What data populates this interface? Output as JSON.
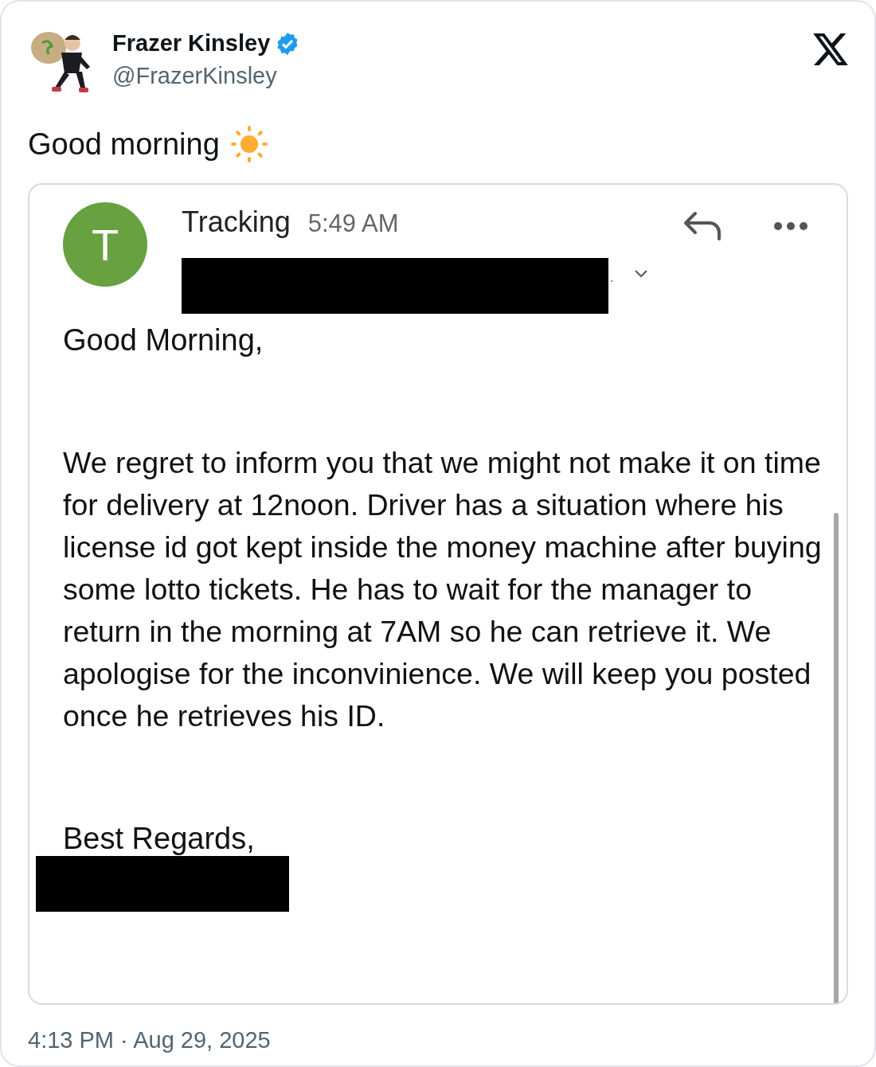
{
  "author": {
    "name": "Frazer Kinsley",
    "verified": true,
    "handle": "@FrazerKinsley"
  },
  "tweet_text": "Good morning",
  "email": {
    "avatar_letter": "T",
    "sender": "Tracking",
    "time": "5:49 AM",
    "recipient_suffix": ".",
    "greeting": "Good Morning,",
    "body": "We regret to inform you that we might not make it on time for delivery at 12noon. Driver has a situation where his license id got kept inside the money machine after buying some lotto tickets. He has to wait for the manager to return in the morning at 7AM so he can retrieve it. We apologise for the inconvinience. We will keep you posted once he retrieves his ID.",
    "closing": "Best Regards,"
  },
  "timestamp": "4:13 PM · Aug 29, 2025"
}
